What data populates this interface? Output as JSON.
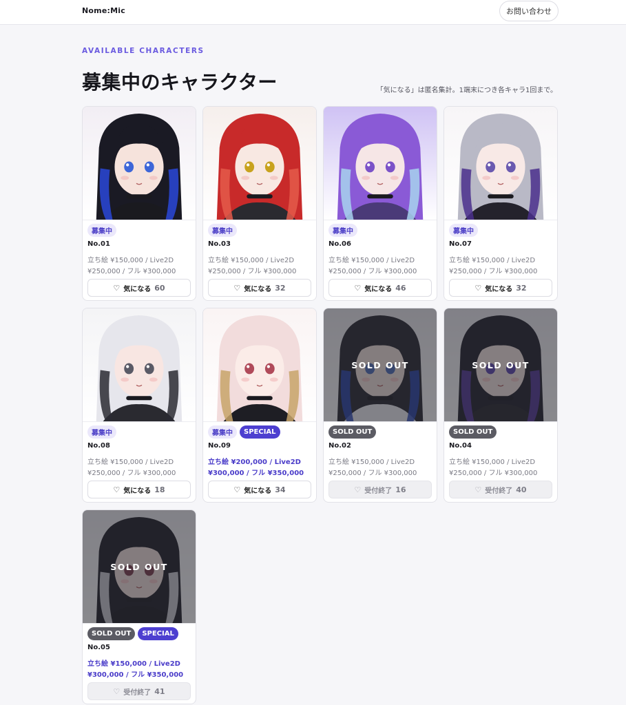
{
  "header": {
    "brand": "Nome:Mic",
    "contact_label": "お問い合わせ"
  },
  "section": {
    "eyebrow": "AVAILABLE CHARACTERS",
    "title": "募集中のキャラクター",
    "notice": "「気になる」は匿名集計。1端末につき各キャラ1回まで。"
  },
  "cards": [
    {
      "no": "No.01",
      "badges": [
        "募集中"
      ],
      "price_line1": "立ち絵 ¥150,000 / Live2D",
      "price_line2": "¥250,000 / フル ¥300,000",
      "button_label": "気になる",
      "count": "60",
      "sold_out": false,
      "special": false,
      "palette": {
        "bg": "#f2eef4",
        "hair": "#1a1a24",
        "accent": "#2a48d8",
        "skin": "#f6e3dc",
        "eyes": "#3d66d8",
        "cloth": "#1a1a1f"
      }
    },
    {
      "no": "No.03",
      "badges": [
        "募集中"
      ],
      "price_line1": "立ち絵 ¥150,000 / Live2D",
      "price_line2": "¥250,000 / フル ¥300,000",
      "button_label": "気になる",
      "count": "32",
      "sold_out": false,
      "special": false,
      "palette": {
        "bg": "#f6efec",
        "hair": "#c82a2a",
        "accent": "#e45a4a",
        "skin": "#f8e8e2",
        "eyes": "#c8a21e",
        "cloth": "#2a2a30"
      }
    },
    {
      "no": "No.06",
      "badges": [
        "募集中"
      ],
      "price_line1": "立ち絵 ¥150,000 / Live2D",
      "price_line2": "¥250,000 / フル ¥300,000",
      "button_label": "気になる",
      "count": "46",
      "sold_out": false,
      "special": false,
      "palette": {
        "bg": "#cfc2f4",
        "hair": "#8a5ad6",
        "accent": "#a7d4ef",
        "skin": "#f6e6e6",
        "eyes": "#7b52c8",
        "cloth": "#4a3a78"
      }
    },
    {
      "no": "No.07",
      "badges": [
        "募集中"
      ],
      "price_line1": "立ち絵 ¥150,000 / Live2D",
      "price_line2": "¥250,000 / フル ¥300,000",
      "button_label": "気になる",
      "count": "32",
      "sold_out": false,
      "special": false,
      "palette": {
        "bg": "#f7f5f7",
        "hair": "#b9b9c6",
        "accent": "#4a2f8c",
        "skin": "#f8e9e6",
        "eyes": "#6a5ab0",
        "cloth": "#24222c"
      }
    },
    {
      "no": "No.08",
      "badges": [
        "募集中"
      ],
      "price_line1": "立ち絵 ¥150,000 / Live2D",
      "price_line2": "¥250,000 / フル ¥300,000",
      "button_label": "気になる",
      "count": "18",
      "sold_out": false,
      "special": false,
      "palette": {
        "bg": "#f4f4f6",
        "hair": "#e6e6ec",
        "accent": "#2a2a32",
        "skin": "#f8e6e2",
        "eyes": "#5a5a66",
        "cloth": "#2a2a30"
      }
    },
    {
      "no": "No.09",
      "badges": [
        "募集中",
        "SPECIAL"
      ],
      "price_line1": "立ち絵 ¥200,000 / Live2D",
      "price_line2": "¥300,000 / フル ¥350,000",
      "button_label": "気になる",
      "count": "34",
      "sold_out": false,
      "special": true,
      "palette": {
        "bg": "#faf4f4",
        "hair": "#f2dcdc",
        "accent": "#c8a46a",
        "skin": "#fbece8",
        "eyes": "#b04a5a",
        "cloth": "#1e1e24"
      }
    },
    {
      "no": "No.02",
      "badges": [
        "SOLD OUT"
      ],
      "price_line1": "立ち絵 ¥150,000 / Live2D",
      "price_line2": "¥250,000 / フル ¥300,000",
      "button_label": "受付終了",
      "count": "16",
      "sold_out": true,
      "special": false,
      "overlay_label": "SOLD OUT",
      "palette": {
        "bg": "#ecebef",
        "hair": "#25252e",
        "accent": "#2848b8",
        "skin": "#f4e4de",
        "eyes": "#4a6ab8",
        "cloth": "#f0f0f4"
      }
    },
    {
      "no": "No.04",
      "badges": [
        "SOLD OUT"
      ],
      "price_line1": "立ち絵 ¥150,000 / Live2D",
      "price_line2": "¥250,000 / フル ¥300,000",
      "button_label": "受付終了",
      "count": "40",
      "sold_out": true,
      "special": false,
      "overlay_label": "SOLD OUT",
      "palette": {
        "bg": "#eeedf2",
        "hair": "#1e1e28",
        "accent": "#5a3aa8",
        "skin": "#f6e6e2",
        "eyes": "#5a44b0",
        "cloth": "#24242c"
      }
    },
    {
      "no": "No.05",
      "badges": [
        "SOLD OUT",
        "SPECIAL"
      ],
      "price_line1": "立ち絵 ¥150,000 / Live2D",
      "price_line2": "¥300,000 / フル ¥350,000",
      "button_label": "受付終了",
      "count": "41",
      "sold_out": true,
      "special": true,
      "overlay_label": "SOLD OUT",
      "palette": {
        "bg": "#efeef2",
        "hair": "#1c1c24",
        "accent": "#e8e8ee",
        "skin": "#f4e2de",
        "eyes": "#7a3a4a",
        "cloth": "#1a1a20"
      }
    }
  ],
  "icons": {
    "like": "heart-outline-icon"
  },
  "colors": {
    "accent": "#6a5ae0",
    "special": "#4d3fd0",
    "soldout": "#5b5b63",
    "page_bg": "#f6f6f9"
  }
}
